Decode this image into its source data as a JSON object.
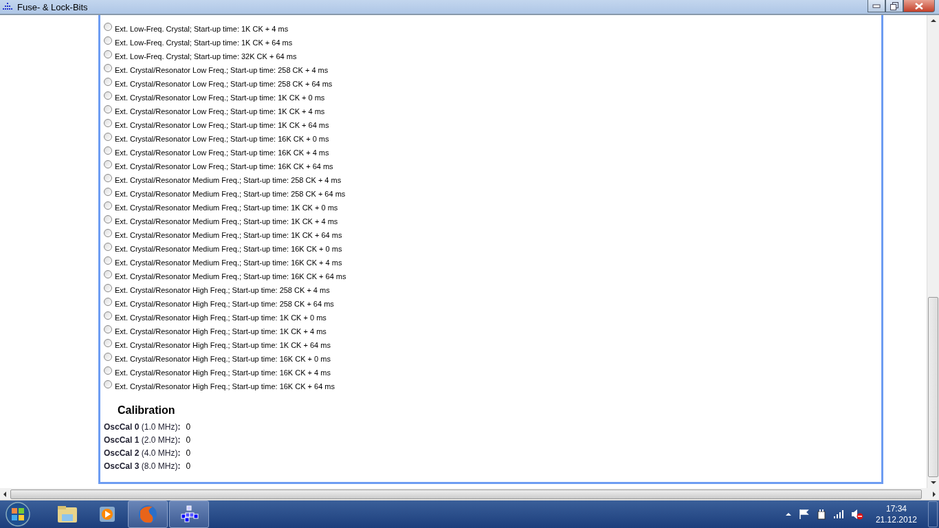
{
  "window": {
    "title": "Fuse- & Lock-Bits"
  },
  "clock_options": [
    {
      "label": "Ext. Low-Freq. Crystal; Start-up time: 1K CK + 4 ms",
      "selected": false
    },
    {
      "label": "Ext. Low-Freq. Crystal; Start-up time: 1K CK + 64 ms",
      "selected": false
    },
    {
      "label": "Ext. Low-Freq. Crystal; Start-up time: 32K CK + 64 ms",
      "selected": false
    },
    {
      "label": "Ext. Crystal/Resonator Low Freq.; Start-up time: 258 CK + 4 ms",
      "selected": false
    },
    {
      "label": "Ext. Crystal/Resonator Low Freq.; Start-up time: 258 CK + 64 ms",
      "selected": false
    },
    {
      "label": "Ext. Crystal/Resonator Low Freq.; Start-up time: 1K CK + 0 ms",
      "selected": false
    },
    {
      "label": "Ext. Crystal/Resonator Low Freq.; Start-up time: 1K CK + 4 ms",
      "selected": false
    },
    {
      "label": "Ext. Crystal/Resonator Low Freq.; Start-up time: 1K CK + 64 ms",
      "selected": false
    },
    {
      "label": "Ext. Crystal/Resonator Low Freq.; Start-up time: 16K CK + 0 ms",
      "selected": false
    },
    {
      "label": "Ext. Crystal/Resonator Low Freq.; Start-up time: 16K CK + 4 ms",
      "selected": false
    },
    {
      "label": "Ext. Crystal/Resonator Low Freq.; Start-up time: 16K CK + 64 ms",
      "selected": false
    },
    {
      "label": "Ext. Crystal/Resonator Medium Freq.; Start-up time: 258 CK + 4 ms",
      "selected": false
    },
    {
      "label": "Ext. Crystal/Resonator Medium Freq.; Start-up time: 258 CK + 64 ms",
      "selected": false
    },
    {
      "label": "Ext. Crystal/Resonator Medium Freq.; Start-up time: 1K CK + 0 ms",
      "selected": false
    },
    {
      "label": "Ext. Crystal/Resonator Medium Freq.; Start-up time: 1K CK + 4 ms",
      "selected": false
    },
    {
      "label": "Ext. Crystal/Resonator Medium Freq.; Start-up time: 1K CK + 64 ms",
      "selected": false
    },
    {
      "label": "Ext. Crystal/Resonator Medium Freq.; Start-up time: 16K CK + 0 ms",
      "selected": false
    },
    {
      "label": "Ext. Crystal/Resonator Medium Freq.; Start-up time: 16K CK + 4 ms",
      "selected": false
    },
    {
      "label": "Ext. Crystal/Resonator Medium Freq.; Start-up time: 16K CK + 64 ms",
      "selected": false
    },
    {
      "label": "Ext. Crystal/Resonator High Freq.; Start-up time: 258 CK + 4 ms",
      "selected": false
    },
    {
      "label": "Ext. Crystal/Resonator High Freq.; Start-up time: 258 CK + 64 ms",
      "selected": false
    },
    {
      "label": "Ext. Crystal/Resonator High Freq.; Start-up time: 1K CK + 0 ms",
      "selected": false
    },
    {
      "label": "Ext. Crystal/Resonator High Freq.; Start-up time: 1K CK + 4 ms",
      "selected": false
    },
    {
      "label": "Ext. Crystal/Resonator High Freq.; Start-up time: 1K CK + 64 ms",
      "selected": false
    },
    {
      "label": "Ext. Crystal/Resonator High Freq.; Start-up time: 16K CK + 0 ms",
      "selected": false
    },
    {
      "label": "Ext. Crystal/Resonator High Freq.; Start-up time: 16K CK + 4 ms",
      "selected": false
    },
    {
      "label": "Ext. Crystal/Resonator High Freq.; Start-up time: 16K CK + 64 ms",
      "selected": false
    }
  ],
  "calibration": {
    "heading": "Calibration",
    "rows": [
      {
        "label": "**OscCal 0** (1.0 MHz)**:**",
        "value": "0"
      },
      {
        "label": "**OscCal 1** (2.0 MHz)**:**",
        "value": "0"
      },
      {
        "label": "**OscCal 2** (4.0 MHz)**:**",
        "value": "0"
      },
      {
        "label": "**OscCal 3** (8.0 MHz)**:**",
        "value": "0"
      }
    ]
  },
  "taskbar": {
    "time": "17:34",
    "date": "21.12.2012"
  }
}
